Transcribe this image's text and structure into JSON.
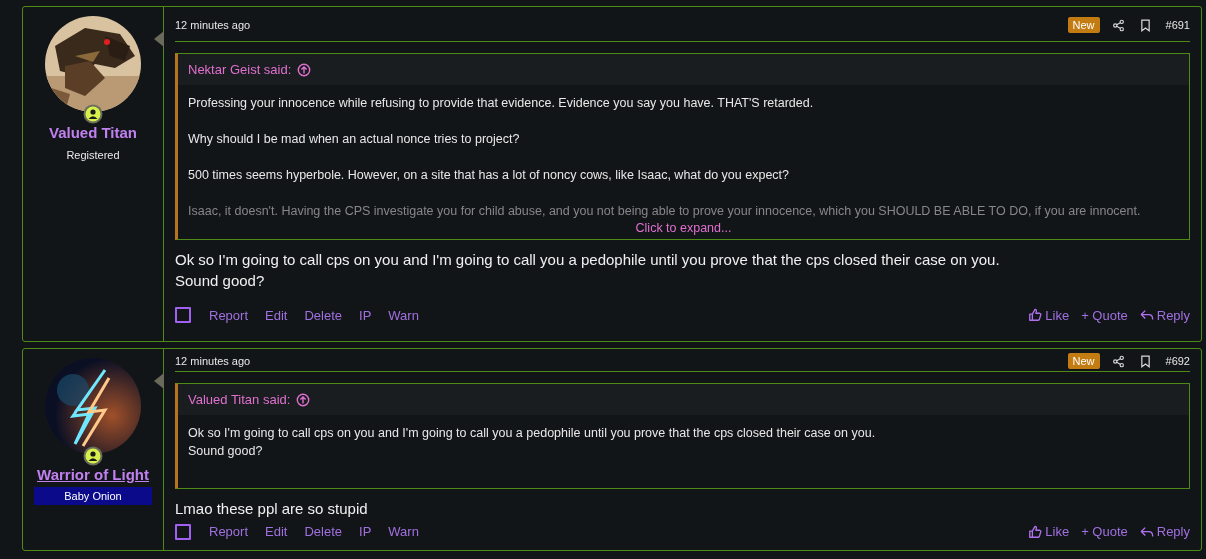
{
  "posts": [
    {
      "author": {
        "name": "Valued Titan",
        "underlined": false,
        "user_title": "Registered",
        "banner": false,
        "online": true
      },
      "time": "12 minutes ago",
      "new_badge": "New",
      "number": "#691",
      "quote": {
        "author": "Nektar Geist said:",
        "paragraphs": [
          "Professing your innocence while refusing to provide that evidence. Evidence you say you have. THAT'S retarded.",
          "Why should I be mad when an actual nonce tries to project?",
          "500 times seems hyperbole. However, on a site that has a lot of noncy cows, like Isaac, what do you expect?",
          "Isaac, it doesn't. Having the CPS investigate you for child abuse, and you not being able to prove your innocence, which you SHOULD BE ABLE TO DO, if you are innocent."
        ],
        "collapsed": true,
        "expand_label": "Click to expand..."
      },
      "body": [
        "Ok so I'm going to call cps on you and I'm going to call you a pedophile until you prove that the cps closed their case on you.",
        "Sound good?"
      ],
      "selected": false,
      "left_actions": [
        "Report",
        "Edit",
        "Delete",
        "IP",
        "Warn"
      ],
      "right_actions": [
        {
          "kind": "like",
          "label": "Like"
        },
        {
          "kind": "quote",
          "label": "+ Quote"
        },
        {
          "kind": "reply",
          "label": "Reply"
        }
      ]
    },
    {
      "author": {
        "name": "Warrior of Light",
        "underlined": true,
        "user_title": "Baby Onion",
        "banner": true,
        "online": true
      },
      "time": "12 minutes ago",
      "new_badge": "New",
      "number": "#692",
      "quote": {
        "author": "Valued Titan said:",
        "paragraphs": [
          "Ok so I'm going to call cps on you and I'm going to call you a pedophile until you prove that the cps closed their case on you.\nSound good?"
        ],
        "collapsed": false
      },
      "body": [
        "Lmao these ppl are so stupid"
      ],
      "selected": false,
      "left_actions": [
        "Report",
        "Edit",
        "Delete",
        "IP",
        "Warn"
      ],
      "right_actions": [
        {
          "kind": "like",
          "label": "Like"
        },
        {
          "kind": "quote",
          "label": "+ Quote"
        },
        {
          "kind": "reply",
          "label": "Reply"
        }
      ]
    }
  ]
}
